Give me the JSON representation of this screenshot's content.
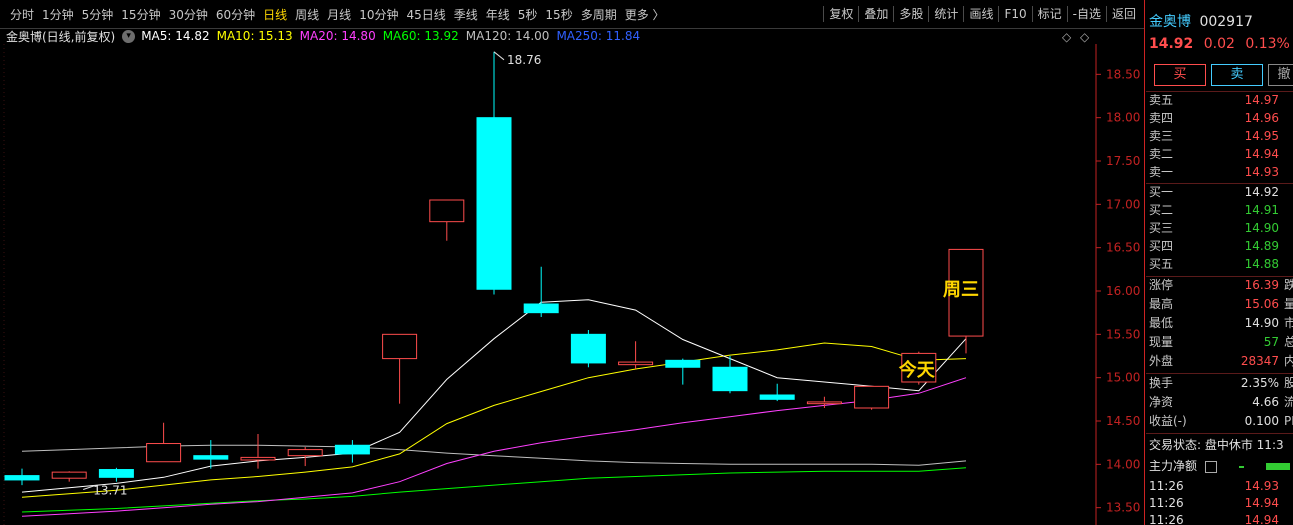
{
  "toolbar": {
    "periods": [
      "分时",
      "1分钟",
      "5分钟",
      "15分钟",
      "30分钟",
      "60分钟",
      "日线",
      "周线",
      "月线",
      "10分钟",
      "45日线",
      "季线",
      "年线",
      "5秒",
      "15秒",
      "多周期",
      "更多 〉"
    ],
    "active_index": 6,
    "tools": [
      "复权",
      "叠加",
      "多股",
      "统计",
      "画线",
      "F10",
      "标记",
      "-自选",
      "返回"
    ]
  },
  "legend": {
    "title": "金奥博(日线,前复权)",
    "dropdown_icon": "▾",
    "ma5": "MA5: 14.82",
    "ma10": "MA10: 15.13",
    "ma20": "MA20: 14.80",
    "ma60": "MA60: 13.92",
    "ma120": "MA120: 14.00",
    "ma250": "MA250: 11.84",
    "ctrl_diamond": "◇",
    "ctrl_square": "◇"
  },
  "colors": {
    "up": "#ff4d4d",
    "down": "#00ffff",
    "ma5": "#ffffff",
    "ma10": "#ffff00",
    "ma20": "#ff40ff",
    "ma60": "#00ff00",
    "ma120": "#bfbfbf",
    "ma250": "#3060ff",
    "axis": "#c22222",
    "annotation": "#ffd700"
  },
  "chart_data": {
    "type": "candlestick",
    "ylim": [
      13.3,
      18.85
    ],
    "yticks": [
      13.5,
      14.0,
      14.5,
      15.0,
      15.5,
      16.0,
      16.5,
      17.0,
      17.5,
      18.0,
      18.5
    ],
    "ytick_labels": [
      "13.50",
      "14.00",
      "14.50",
      "15.00",
      "15.50",
      "16.00",
      "16.50",
      "17.00",
      "17.50",
      "18.00",
      "18.50"
    ],
    "candles": [
      {
        "o": 13.87,
        "h": 13.95,
        "l": 13.76,
        "c": 13.82
      },
      {
        "o": 13.84,
        "h": 13.92,
        "l": 13.8,
        "c": 13.91
      },
      {
        "o": 13.94,
        "h": 13.96,
        "l": 13.8,
        "c": 13.85
      },
      {
        "o": 14.03,
        "h": 14.48,
        "l": 14.03,
        "c": 14.24
      },
      {
        "o": 14.1,
        "h": 14.28,
        "l": 13.95,
        "c": 14.06
      },
      {
        "o": 14.05,
        "h": 14.35,
        "l": 13.95,
        "c": 14.08
      },
      {
        "o": 14.1,
        "h": 14.2,
        "l": 13.98,
        "c": 14.17
      },
      {
        "o": 14.22,
        "h": 14.28,
        "l": 14.02,
        "c": 14.12
      },
      {
        "o": 15.22,
        "h": 15.49,
        "l": 14.7,
        "c": 15.5
      },
      {
        "o": 16.8,
        "h": 17.05,
        "l": 16.58,
        "c": 17.05
      },
      {
        "o": 18.0,
        "h": 18.76,
        "l": 15.96,
        "c": 16.02
      },
      {
        "o": 15.85,
        "h": 16.28,
        "l": 15.7,
        "c": 15.75
      },
      {
        "o": 15.5,
        "h": 15.55,
        "l": 15.12,
        "c": 15.17
      },
      {
        "o": 15.15,
        "h": 15.42,
        "l": 15.1,
        "c": 15.18
      },
      {
        "o": 15.2,
        "h": 15.22,
        "l": 14.92,
        "c": 15.12
      },
      {
        "o": 15.12,
        "h": 15.25,
        "l": 14.82,
        "c": 14.85
      },
      {
        "o": 14.8,
        "h": 14.93,
        "l": 14.73,
        "c": 14.75
      },
      {
        "o": 14.7,
        "h": 14.78,
        "l": 14.65,
        "c": 14.72
      },
      {
        "o": 14.65,
        "h": 14.9,
        "l": 14.63,
        "c": 14.9
      },
      {
        "o": 14.95,
        "h": 15.3,
        "l": 14.92,
        "c": 15.28
      },
      {
        "o": 15.48,
        "h": 16.48,
        "l": 15.28,
        "c": 16.48
      }
    ],
    "ma5": [
      13.68,
      13.73,
      13.78,
      13.85,
      13.98,
      14.04,
      14.08,
      14.13,
      14.37,
      14.98,
      15.45,
      15.87,
      15.9,
      15.78,
      15.44,
      15.22,
      15.0,
      14.95,
      14.9,
      14.85,
      15.45
    ],
    "ma10": [
      13.62,
      13.66,
      13.7,
      13.76,
      13.82,
      13.86,
      13.91,
      13.97,
      14.12,
      14.47,
      14.68,
      14.84,
      15.0,
      15.1,
      15.18,
      15.26,
      15.32,
      15.4,
      15.36,
      15.2,
      15.22
    ],
    "ma20": [
      13.4,
      13.43,
      13.46,
      13.5,
      13.54,
      13.57,
      13.62,
      13.67,
      13.8,
      14.01,
      14.15,
      14.25,
      14.33,
      14.4,
      14.48,
      14.55,
      14.62,
      14.68,
      14.74,
      14.82,
      15.0
    ],
    "ma60": [
      13.45,
      13.47,
      13.49,
      13.52,
      13.55,
      13.58,
      13.6,
      13.63,
      13.68,
      13.72,
      13.76,
      13.8,
      13.84,
      13.86,
      13.88,
      13.9,
      13.91,
      13.92,
      13.92,
      13.92,
      13.96
    ],
    "ma120": [
      14.15,
      14.17,
      14.19,
      14.21,
      14.22,
      14.22,
      14.21,
      14.2,
      14.17,
      14.13,
      14.1,
      14.07,
      14.04,
      14.02,
      14.01,
      14.0,
      14.0,
      14.0,
      14.0,
      13.99,
      14.04
    ],
    "annotations": {
      "high_label": "18.76",
      "low_label": "13.71",
      "today": "今天",
      "wednesday": "周三"
    }
  },
  "quote": {
    "name": "金奥博",
    "code": "002917",
    "price": "14.92",
    "change": "0.02",
    "pct": "0.13%",
    "buy": "买",
    "sell": "卖",
    "cancel": "撤",
    "asks": [
      {
        "l": "卖五",
        "v": "14.97"
      },
      {
        "l": "卖四",
        "v": "14.96"
      },
      {
        "l": "卖三",
        "v": "14.95"
      },
      {
        "l": "卖二",
        "v": "14.94"
      },
      {
        "l": "卖一",
        "v": "14.93"
      }
    ],
    "bids": [
      {
        "l": "买一",
        "v": "14.92"
      },
      {
        "l": "买二",
        "v": "14.91"
      },
      {
        "l": "买三",
        "v": "14.90"
      },
      {
        "l": "买四",
        "v": "14.89"
      },
      {
        "l": "买五",
        "v": "14.88"
      }
    ],
    "stats": [
      {
        "l": "涨停",
        "v": "16.39",
        "r": "跌停"
      },
      {
        "l": "最高",
        "v": "15.06",
        "r": "量比"
      },
      {
        "l": "最低",
        "v": "14.90",
        "r": "市值"
      },
      {
        "l": "现量",
        "v": "57",
        "r": "总量"
      },
      {
        "l": "外盘",
        "v": "28347",
        "r": "内盘"
      }
    ],
    "fin": [
      {
        "l": "换手",
        "v": "2.35%",
        "r": "股本"
      },
      {
        "l": "净资",
        "v": "4.66",
        "r": "流通"
      },
      {
        "l": "收益(-)",
        "v": "0.100",
        "r": "PE(动"
      }
    ],
    "status": "交易状态: 盘中休市 11:3",
    "net_flow": "主力净额",
    "ticks": [
      {
        "t": "11:26",
        "v": "14.93"
      },
      {
        "t": "11:26",
        "v": "14.94"
      },
      {
        "t": "11:26",
        "v": "14.94"
      }
    ]
  }
}
